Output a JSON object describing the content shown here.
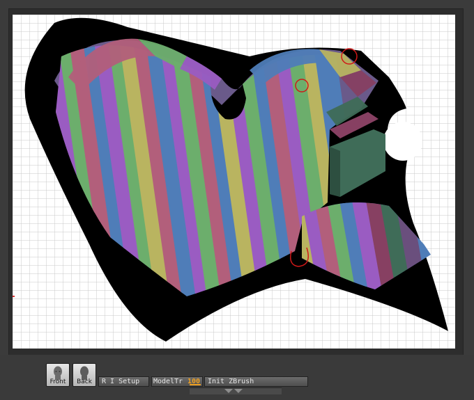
{
  "app": {
    "name": "ZBrush"
  },
  "view_buttons": {
    "front_label": "Front",
    "back_label": "Back"
  },
  "toolbar": {
    "ri_setup_label": "R I Setup",
    "modeltr_label": "ModelTr",
    "modeltr_value": "100",
    "init_zbrush_label": "Init ZBrush"
  },
  "icons": [
    "front-head-icon",
    "back-head-icon",
    "grip-arrow-icon"
  ],
  "colors": {
    "background": "#3b3b3b",
    "canvas": "#ffffff",
    "grid": "#c8c8c8",
    "shadow": "#000000",
    "stripe_colors": [
      "#4f7db8",
      "#b25f7b",
      "#9a5cc2",
      "#6cae6c",
      "#b9b460",
      "#3f6c58",
      "#874062"
    ],
    "annotation": "#d01818",
    "accent": "#f0a020"
  }
}
